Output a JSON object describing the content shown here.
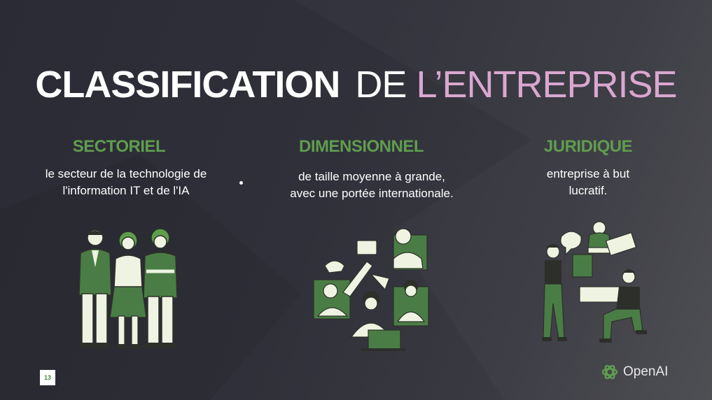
{
  "title": {
    "part1": "CLASSIFICATION",
    "part2": "DE",
    "part3": "L’ENTREPRISE"
  },
  "columns": [
    {
      "heading": "SECTORIEL",
      "line1": "le secteur de la technologie de",
      "line2": "l'information IT et de l'IA"
    },
    {
      "heading": "DIMENSIONNEL",
      "line1": "de taille moyenne à grande,",
      "line2": "avec une portée internationale."
    },
    {
      "heading": "JURIDIQUE",
      "line1": "entreprise à but",
      "line2": "lucratif."
    }
  ],
  "page_number": "13",
  "brand": {
    "name": "OpenAI",
    "icon": "openai-logo-icon"
  },
  "colors": {
    "accent_green": "#5f9d4e",
    "accent_pink": "#d9a7d0",
    "figure_cream": "#eef4e1",
    "figure_dark": "#2d2f2a"
  }
}
